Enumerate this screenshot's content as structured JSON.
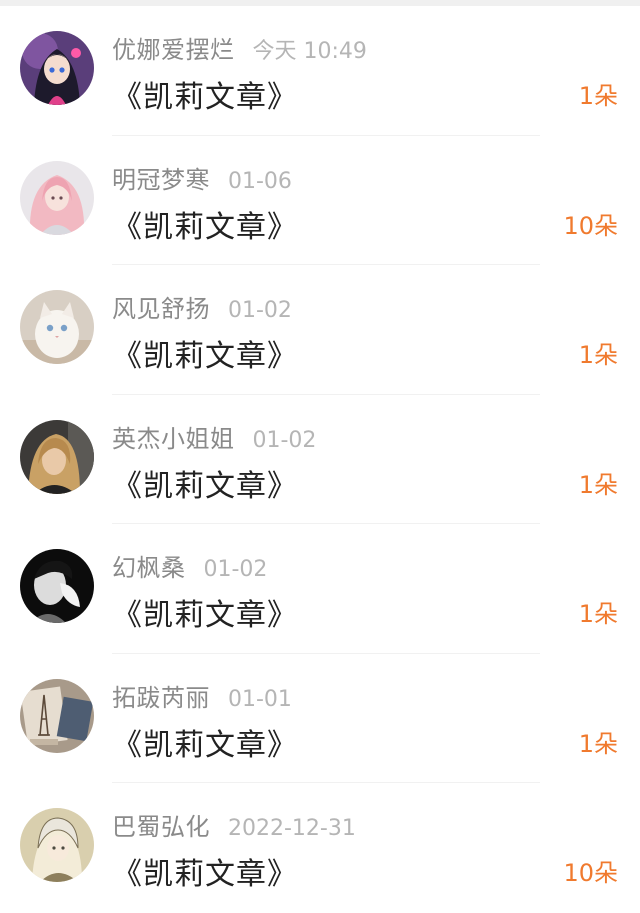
{
  "items": [
    {
      "name": "优娜爱摆烂",
      "time": "今天 10:49",
      "title": "《凯莉文章》",
      "count": "1朵",
      "avatar_icon": "anime-girl-avatar"
    },
    {
      "name": "明冠梦寒",
      "time": "01-06",
      "title": "《凯莉文章》",
      "count": "10朵",
      "avatar_icon": "pink-hair-girl-avatar"
    },
    {
      "name": "风见舒扬",
      "time": "01-02",
      "title": "《凯莉文章》",
      "count": "1朵",
      "avatar_icon": "white-cat-avatar"
    },
    {
      "name": "英杰小姐姐",
      "time": "01-02",
      "title": "《凯莉文章》",
      "count": "1朵",
      "avatar_icon": "blonde-girl-avatar"
    },
    {
      "name": "幻枫桑",
      "time": "01-02",
      "title": "《凯莉文章》",
      "count": "1朵",
      "avatar_icon": "bw-portrait-avatar"
    },
    {
      "name": "拓跋芮丽",
      "time": "01-01",
      "title": "《凯莉文章》",
      "count": "1朵",
      "avatar_icon": "eiffel-tower-avatar"
    },
    {
      "name": "巴蜀弘化",
      "time": "2022-12-31",
      "title": "《凯莉文章》",
      "count": "10朵",
      "avatar_icon": "anime-sketch-avatar"
    }
  ],
  "colors": {
    "count": "#f07a2e",
    "name": "#8a8a8a",
    "time": "#b5b5b5",
    "title": "#222222"
  }
}
